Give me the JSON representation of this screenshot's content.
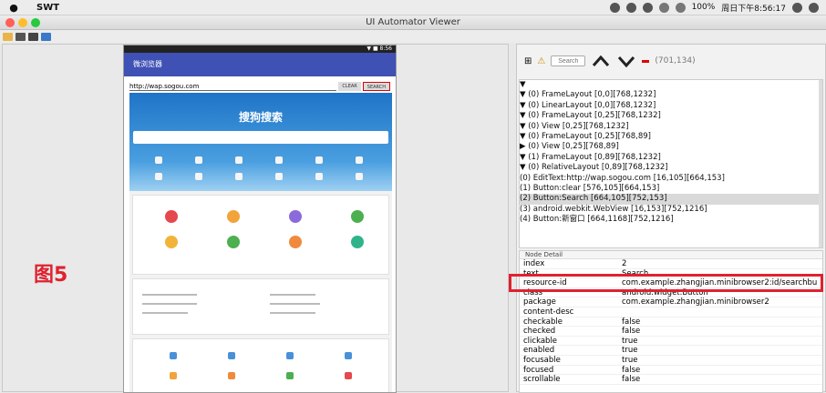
{
  "menubar": {
    "app": "SWT",
    "battery": "100%",
    "clock": "周日下午8:56:17"
  },
  "window": {
    "title": "UI Automator Viewer"
  },
  "rtoolbar": {
    "search_placeholder": "Search",
    "coords": "(701,134)"
  },
  "device": {
    "app_title": "微浏览器",
    "url": "http://wap.sogou.com",
    "clear": "CLEAR",
    "search": "SEARCH",
    "sogou": "搜狗搜索"
  },
  "tree": [
    "▼",
    "▼ (0) FrameLayout [0,0][768,1232]",
    "   ▼ (0) LinearLayout [0,0][768,1232]",
    "      ▼ (0) FrameLayout [0,25][768,1232]",
    "         ▼ (0) View [0,25][768,1232]",
    "            ▼ (0) FrameLayout [0,25][768,89]",
    "               ▶ (0) View [0,25][768,89]",
    "            ▼ (1) FrameLayout [0,89][768,1232]",
    "               ▼ (0) RelativeLayout [0,89][768,1232]",
    "                    (0) EditText:http://wap.sogou.com [16,105][664,153]",
    "                    (1) Button:clear [576,105][664,153]",
    "                    (2) Button:Search [664,105][752,153]",
    "                    (3) android.webkit.WebView [16,153][752,1216]",
    "                    (4) Button:新窗口 [664,1168][752,1216]"
  ],
  "detail": {
    "header": "Node Detail",
    "rows": [
      {
        "k": "index",
        "v": "2"
      },
      {
        "k": "text",
        "v": "Search"
      },
      {
        "k": "resource-id",
        "v": "com.example.zhangjian.minibrowser2:id/searchbu"
      },
      {
        "k": "class",
        "v": "android.widget.Button"
      },
      {
        "k": "package",
        "v": "com.example.zhangjian.minibrowser2"
      },
      {
        "k": "content-desc",
        "v": ""
      },
      {
        "k": "checkable",
        "v": "false"
      },
      {
        "k": "checked",
        "v": "false"
      },
      {
        "k": "clickable",
        "v": "true"
      },
      {
        "k": "enabled",
        "v": "true"
      },
      {
        "k": "focusable",
        "v": "true"
      },
      {
        "k": "focused",
        "v": "false"
      },
      {
        "k": "scrollable",
        "v": "false"
      }
    ]
  },
  "figure_label": "图5"
}
